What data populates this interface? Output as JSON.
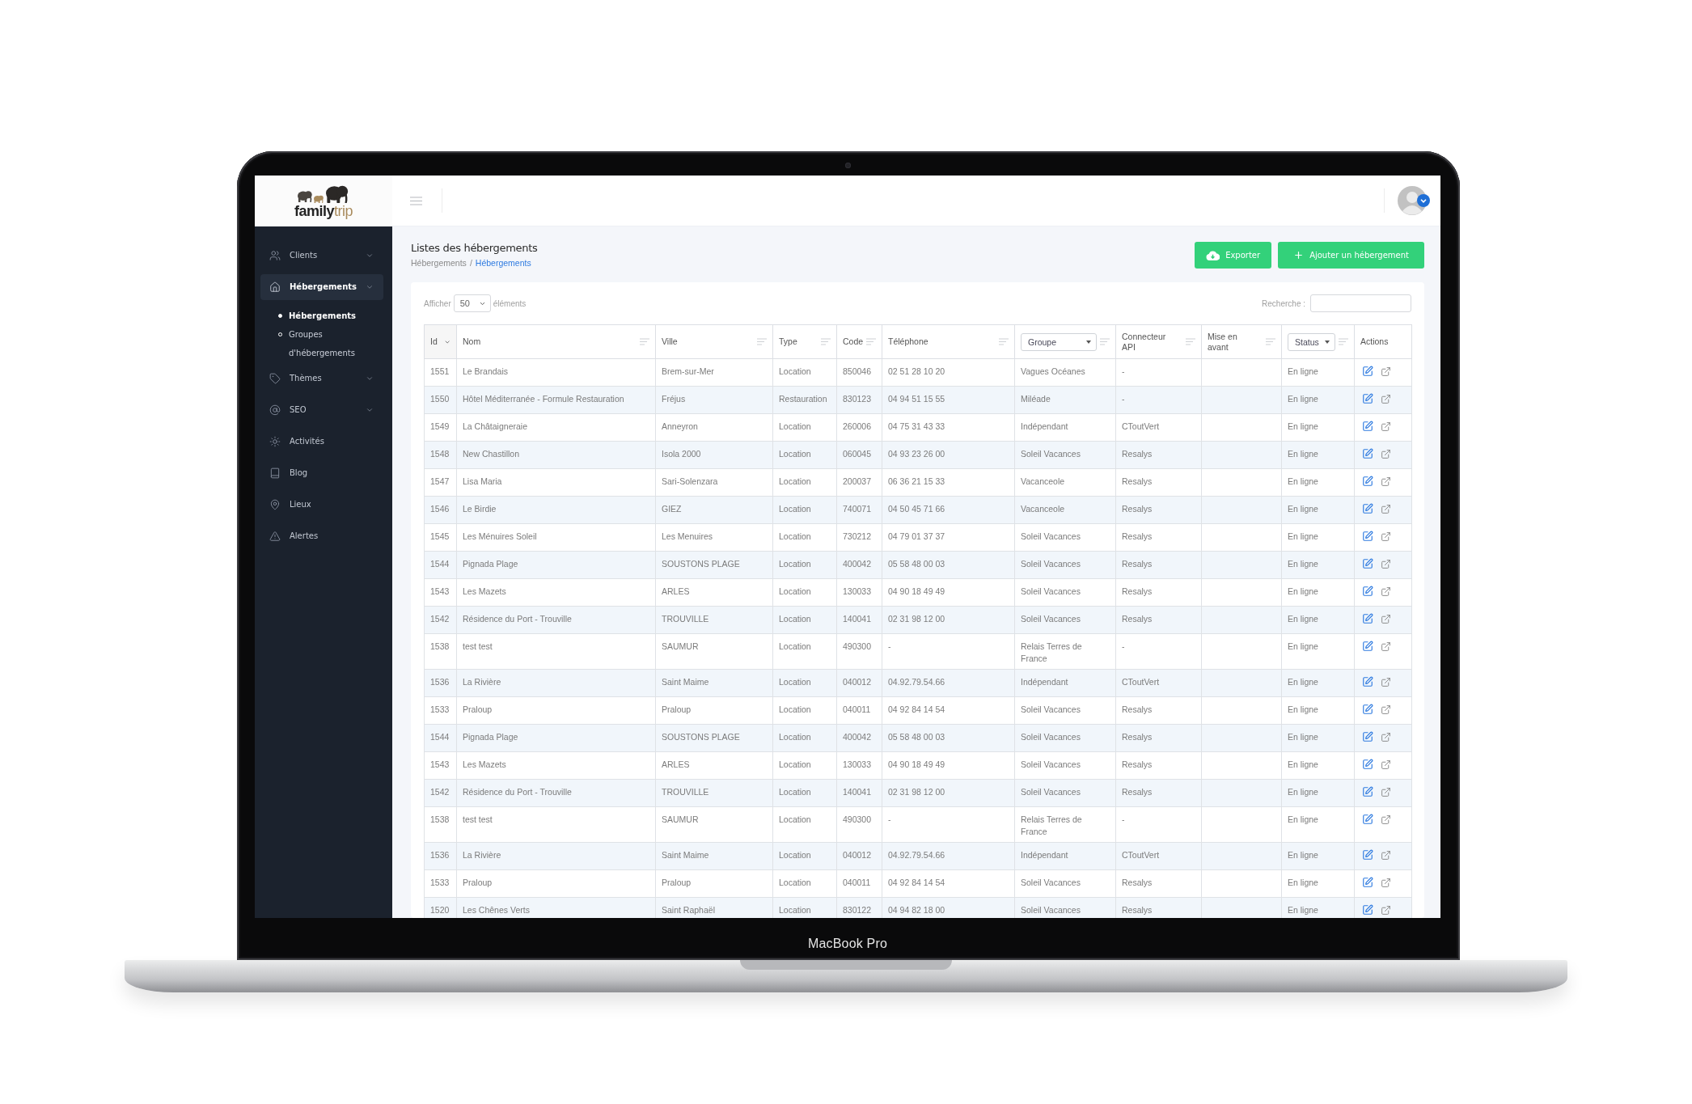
{
  "device": {
    "label": "MacBook Pro"
  },
  "logo": {
    "text": "family",
    "accent": "trip"
  },
  "sidebar": {
    "items": [
      {
        "label": "Clients",
        "kind": "dropdown",
        "selected": false
      },
      {
        "label": "Hébergements",
        "kind": "dropdown",
        "selected": true,
        "children": [
          {
            "label": "Hébergements",
            "selected": true
          },
          {
            "label": "Groupes d'hébergements",
            "selected": false
          }
        ]
      },
      {
        "label": "Thèmes",
        "kind": "dropdown",
        "selected": false
      },
      {
        "label": "SEO",
        "kind": "dropdown",
        "selected": false
      },
      {
        "label": "Activités",
        "kind": "link",
        "selected": false
      },
      {
        "label": "Blog",
        "kind": "link",
        "selected": false
      },
      {
        "label": "Lieux",
        "kind": "link",
        "selected": false
      },
      {
        "label": "Alertes",
        "kind": "link",
        "selected": false
      }
    ]
  },
  "page": {
    "title": "Listes des hébergements",
    "breadcrumb": [
      {
        "label": "Hébergements",
        "active": false
      },
      {
        "label": "Hébergements",
        "active": true
      }
    ],
    "breadcrumb_separator": "/",
    "buttons": [
      {
        "label": "Exporter",
        "kind": "export"
      },
      {
        "label": "Ajouter un hébergement",
        "kind": "add"
      }
    ]
  },
  "table_controls": {
    "show_label": "Afficher",
    "page_length": "50",
    "entries_label": "éléments",
    "search_label": "Recherche :"
  },
  "table": {
    "columns": [
      {
        "label": "Id",
        "kind": "sorted"
      },
      {
        "label": "Nom",
        "kind": "sortable"
      },
      {
        "label": "Ville",
        "kind": "sortable"
      },
      {
        "label": "Type",
        "kind": "sortable"
      },
      {
        "label": "Code",
        "kind": "sortable"
      },
      {
        "label": "Téléphone",
        "kind": "sortable"
      },
      {
        "label": "Groupe",
        "kind": "filter"
      },
      {
        "label": "Connecteur API",
        "kind": "sortable"
      },
      {
        "label": "Mise en avant",
        "kind": "sortable"
      },
      {
        "label": "Status",
        "kind": "filter"
      },
      {
        "label": "Actions",
        "kind": "plain"
      }
    ],
    "rows": [
      {
        "id": "1551",
        "name": "Le Brandais",
        "city": "Brem-sur-Mer",
        "type": "Location",
        "code": "850046",
        "phone": "02 51 28 10 20",
        "group": "Vagues Océanes",
        "connector": "-",
        "status": "En ligne"
      },
      {
        "id": "1550",
        "name": "Hôtel Méditerranée - Formule Restauration",
        "city": "Fréjus",
        "type": "Restauration",
        "code": "830123",
        "phone": "04 94 51 15 55",
        "group": "Miléade",
        "connector": "-",
        "status": "En ligne"
      },
      {
        "id": "1549",
        "name": "La Châtaigneraie",
        "city": "Anneyron",
        "type": "Location",
        "code": "260006",
        "phone": "04 75 31 43 33",
        "group": "Indépendant",
        "connector": "CToutVert",
        "status": "En ligne"
      },
      {
        "id": "1548",
        "name": "New Chastillon",
        "city": "Isola 2000",
        "type": "Location",
        "code": "060045",
        "phone": "04 93 23 26 00",
        "group": "Soleil Vacances",
        "connector": "Resalys",
        "status": "En ligne"
      },
      {
        "id": "1547",
        "name": "Lisa Maria",
        "city": "Sari-Solenzara",
        "type": "Location",
        "code": "200037",
        "phone": "06 36 21 15 33",
        "group": "Vacanceole",
        "connector": "Resalys",
        "status": "En ligne"
      },
      {
        "id": "1546",
        "name": "Le Birdie",
        "city": "GIEZ",
        "type": "Location",
        "code": "740071",
        "phone": "04 50 45 71 66",
        "group": "Vacanceole",
        "connector": "Resalys",
        "status": "En ligne"
      },
      {
        "id": "1545",
        "name": "Les Ménuires Soleil",
        "city": "Les Menuires",
        "type": "Location",
        "code": "730212",
        "phone": "04 79 01 37 37",
        "group": "Soleil Vacances",
        "connector": "Resalys",
        "status": "En ligne"
      },
      {
        "id": "1544",
        "name": "Pignada Plage",
        "city": "SOUSTONS PLAGE",
        "type": "Location",
        "code": "400042",
        "phone": "05 58 48 00 03",
        "group": "Soleil Vacances",
        "connector": "Resalys",
        "status": "En ligne"
      },
      {
        "id": "1543",
        "name": "Les Mazets",
        "city": "ARLES",
        "type": "Location",
        "code": "130033",
        "phone": "04 90 18 49 49",
        "group": "Soleil Vacances",
        "connector": "Resalys",
        "status": "En ligne"
      },
      {
        "id": "1542",
        "name": "Résidence du Port - Trouville",
        "city": "TROUVILLE",
        "type": "Location",
        "code": "140041",
        "phone": "02 31 98 12 00",
        "group": "Soleil Vacances",
        "connector": "Resalys",
        "status": "En ligne"
      },
      {
        "id": "1538",
        "name": "test test",
        "city": "SAUMUR",
        "type": "Location",
        "code": "490300",
        "phone": "-",
        "group": "Relais Terres de France",
        "connector": "-",
        "status": "En ligne"
      },
      {
        "id": "1536",
        "name": "La Rivière",
        "city": "Saint Maime",
        "type": "Location",
        "code": "040012",
        "phone": "04.92.79.54.66",
        "group": "Indépendant",
        "connector": "CToutVert",
        "status": "En ligne"
      },
      {
        "id": "1533",
        "name": "Praloup",
        "city": "Praloup",
        "type": "Location",
        "code": "040011",
        "phone": "04 92 84 14 54",
        "group": "Soleil Vacances",
        "connector": "Resalys",
        "status": "En ligne"
      },
      {
        "id": "1544",
        "name": "Pignada Plage",
        "city": "SOUSTONS PLAGE",
        "type": "Location",
        "code": "400042",
        "phone": "05 58 48 00 03",
        "group": "Soleil Vacances",
        "connector": "Resalys",
        "status": "En ligne"
      },
      {
        "id": "1543",
        "name": "Les Mazets",
        "city": "ARLES",
        "type": "Location",
        "code": "130033",
        "phone": "04 90 18 49 49",
        "group": "Soleil Vacances",
        "connector": "Resalys",
        "status": "En ligne"
      },
      {
        "id": "1542",
        "name": "Résidence du Port - Trouville",
        "city": "TROUVILLE",
        "type": "Location",
        "code": "140041",
        "phone": "02 31 98 12 00",
        "group": "Soleil Vacances",
        "connector": "Resalys",
        "status": "En ligne"
      },
      {
        "id": "1538",
        "name": "test test",
        "city": "SAUMUR",
        "type": "Location",
        "code": "490300",
        "phone": "-",
        "group": "Relais Terres de France",
        "connector": "-",
        "status": "En ligne"
      },
      {
        "id": "1536",
        "name": "La Rivière",
        "city": "Saint Maime",
        "type": "Location",
        "code": "040012",
        "phone": "04.92.79.54.66",
        "group": "Indépendant",
        "connector": "CToutVert",
        "status": "En ligne"
      },
      {
        "id": "1533",
        "name": "Praloup",
        "city": "Praloup",
        "type": "Location",
        "code": "040011",
        "phone": "04 92 84 14 54",
        "group": "Soleil Vacances",
        "connector": "Resalys",
        "status": "En ligne"
      },
      {
        "id": "1520",
        "name": "Les Chênes Verts",
        "city": "Saint Raphaël",
        "type": "Location",
        "code": "830122",
        "phone": "04 94 82 18 00",
        "group": "Soleil Vacances",
        "connector": "Resalys",
        "status": "En ligne"
      }
    ]
  }
}
